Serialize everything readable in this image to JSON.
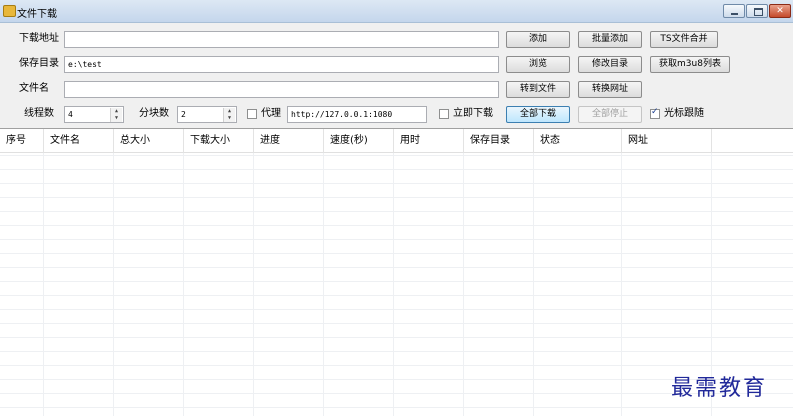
{
  "window": {
    "title": "文件下载",
    "controls": [
      "minimize-icon",
      "maximize-icon",
      "close-icon"
    ]
  },
  "form": {
    "url_label": "下载地址",
    "url_value": "",
    "dir_label": "保存目录",
    "dir_value": "e:\\test",
    "name_label": "文件名",
    "name_value": "",
    "threads_label": "线程数",
    "threads_value": "4",
    "chunks_label": "分块数",
    "chunks_value": "2",
    "proxy_label": "代理",
    "proxy_checked": false,
    "proxy_value": "http://127.0.0.1:1080",
    "immediate_label": "立即下载",
    "immediate_checked": false,
    "follow_label": "光标跟随",
    "follow_checked": true
  },
  "buttons": {
    "add": "添加",
    "batch_add": "批量添加",
    "ts_merge": "TS文件合并",
    "browse": "浏览",
    "change_dir": "修改目录",
    "get_m3u8": "获取m3u8列表",
    "to_file": "转到文件",
    "convert_url": "转换网址",
    "download_all": "全部下载",
    "stop_all": "全部停止"
  },
  "table": {
    "columns": [
      "序号",
      "文件名",
      "总大小",
      "下载大小",
      "进度",
      "速度(秒)",
      "用时",
      "保存目录",
      "状态",
      "网址"
    ],
    "rows": []
  },
  "watermark": "最需教育"
}
